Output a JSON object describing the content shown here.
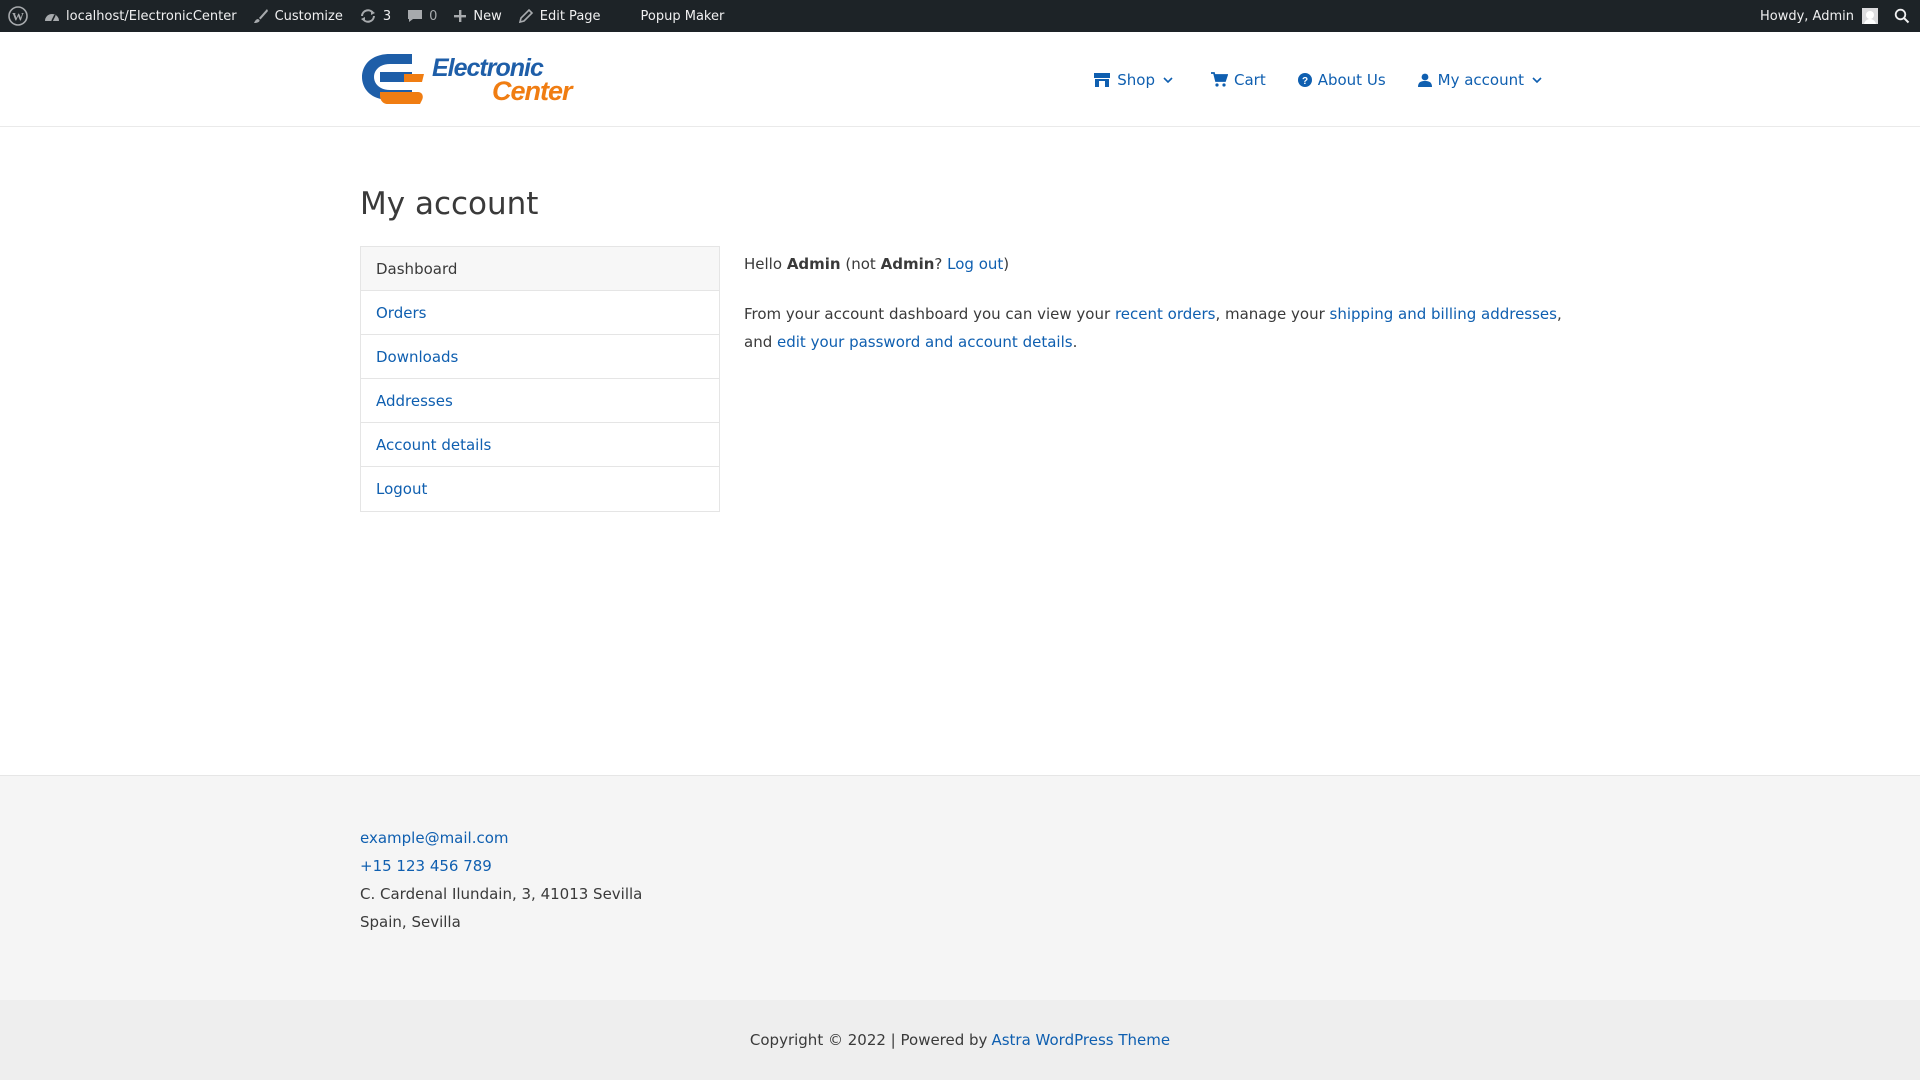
{
  "admin_bar": {
    "site": "localhost/ElectronicCenter",
    "customize": "Customize",
    "updates": "3",
    "comments": "0",
    "new": "New",
    "edit_page": "Edit Page",
    "popup_maker": "Popup Maker",
    "howdy": "Howdy, Admin"
  },
  "logo": {
    "line1": "Electronic",
    "line2": "Center"
  },
  "nav": {
    "shop": "Shop",
    "cart": "Cart",
    "about": "About Us",
    "account": "My account"
  },
  "page": {
    "title": "My account"
  },
  "account_nav": [
    "Dashboard",
    "Orders",
    "Downloads",
    "Addresses",
    "Account details",
    "Logout"
  ],
  "dashboard": {
    "hello": "Hello",
    "user": "Admin",
    "not": "(not",
    "user2": "Admin",
    "q": "?",
    "logout": "Log out",
    "close": ")",
    "intro": "From your account dashboard you can view your",
    "recent_orders": "recent orders",
    "manage": ", manage your",
    "addresses": "shipping and billing addresses",
    "and": ", and",
    "edit": "edit your password and account details",
    "end": "."
  },
  "footer": {
    "email": "example@mail.com",
    "phone": "+15 123 456 789",
    "address1": "C. Cardenal Ilundain, 3, 41013 Sevilla",
    "address2": "Spain, Sevilla"
  },
  "copyright": {
    "text": "Copyright © 2022 | Powered by",
    "link": "Astra WordPress Theme"
  },
  "colors": {
    "link": "#0f5fb0",
    "adminbar": "#1d2327",
    "logo_blue": "#1e5ea8",
    "logo_orange": "#f07d12"
  }
}
